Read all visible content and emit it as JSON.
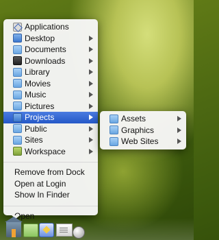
{
  "main_menu": {
    "folders": [
      {
        "label": "Applications",
        "icon": "applications-folder-icon",
        "has_submenu": false
      },
      {
        "label": "Desktop",
        "icon": "desktop-folder-icon",
        "has_submenu": true
      },
      {
        "label": "Documents",
        "icon": "documents-folder-icon",
        "has_submenu": true
      },
      {
        "label": "Downloads",
        "icon": "downloads-folder-icon",
        "has_submenu": true
      },
      {
        "label": "Library",
        "icon": "library-folder-icon",
        "has_submenu": true
      },
      {
        "label": "Movies",
        "icon": "movies-folder-icon",
        "has_submenu": true
      },
      {
        "label": "Music",
        "icon": "music-folder-icon",
        "has_submenu": true
      },
      {
        "label": "Pictures",
        "icon": "pictures-folder-icon",
        "has_submenu": true
      },
      {
        "label": "Projects",
        "icon": "projects-folder-icon",
        "has_submenu": true,
        "selected": true
      },
      {
        "label": "Public",
        "icon": "public-folder-icon",
        "has_submenu": true
      },
      {
        "label": "Sites",
        "icon": "sites-folder-icon",
        "has_submenu": true
      },
      {
        "label": "Workspace",
        "icon": "workspace-folder-icon",
        "has_submenu": true
      }
    ],
    "dock_actions": [
      {
        "label": "Remove from Dock"
      },
      {
        "label": "Open at Login"
      },
      {
        "label": "Show In Finder"
      }
    ],
    "open_label": "Open"
  },
  "submenu": {
    "items": [
      {
        "label": "Assets",
        "has_submenu": true
      },
      {
        "label": "Graphics",
        "has_submenu": true
      },
      {
        "label": "Web Sites",
        "has_submenu": true
      }
    ]
  },
  "colors": {
    "selection": "#2f63d1",
    "menu_background": "#f6f6f6"
  },
  "dock": {
    "icons": [
      "home-folder-icon",
      "green-folder-icon",
      "applications-icon",
      "mail-icon",
      "clock-icon"
    ]
  }
}
